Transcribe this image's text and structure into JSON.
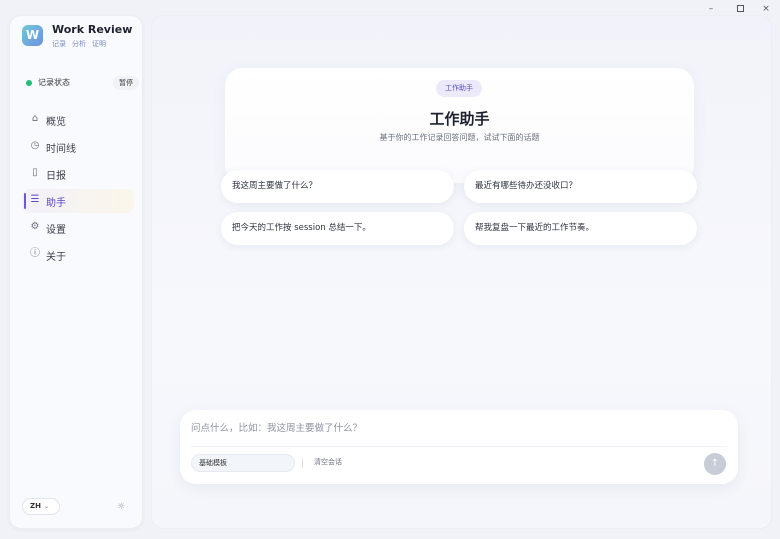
{
  "window": {
    "controls": {
      "minimize": "–",
      "close": "×"
    }
  },
  "app": {
    "logo_letter": "W",
    "name": "Work Review",
    "subtitle": [
      "记录",
      "分析",
      "证明"
    ]
  },
  "recording": {
    "label": "记录状态",
    "status_color": "#1fbe7b",
    "pause_label": "暂停"
  },
  "nav": {
    "items": [
      {
        "label": "概览",
        "icon": "home-icon",
        "glyph": "⌂",
        "active": false
      },
      {
        "label": "时间线",
        "icon": "clock-icon",
        "glyph": "◷",
        "active": false
      },
      {
        "label": "日报",
        "icon": "document-icon",
        "glyph": "▯",
        "active": false
      },
      {
        "label": "助手",
        "icon": "assistant-icon",
        "glyph": "☰",
        "active": true
      },
      {
        "label": "设置",
        "icon": "gear-icon",
        "glyph": "⚙",
        "active": false
      },
      {
        "label": "关于",
        "icon": "info-icon",
        "glyph": "ⓘ",
        "active": false
      }
    ]
  },
  "footer": {
    "language": "ZH",
    "language_chevron": "⌄",
    "theme_icon": "☼"
  },
  "assistant": {
    "tag": "工作助手",
    "title": "工作助手",
    "subtitle": "基于你的工作记录回答问题，试试下面的话题",
    "suggestions": [
      "我这周主要做了什么？",
      "最近有哪些待办还没收口？",
      "把今天的工作按 session 总结一下。",
      "帮我复盘一下最近的工作节奏。"
    ]
  },
  "composer": {
    "placeholder": "问点什么，比如：我这周主要做了什么？",
    "model_label": "基础模板",
    "clear_label": "清空会话",
    "send_glyph": "↑"
  },
  "colors": {
    "accent": "#6d57d8",
    "background": "#f1f2f8"
  }
}
